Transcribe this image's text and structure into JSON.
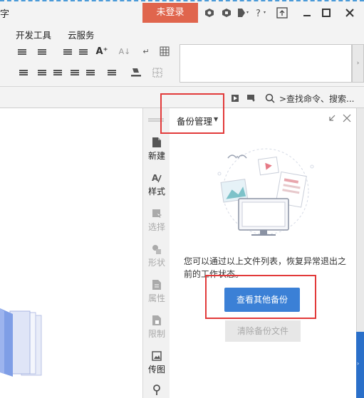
{
  "window": {
    "title_fragment": "字",
    "login_label": "未登录"
  },
  "menu": {
    "items": [
      "开发工具",
      "云服务"
    ]
  },
  "searchbar": {
    "label": ">查找命令、搜索..."
  },
  "toolstrip": {
    "items": [
      {
        "label": "新建",
        "icon": "new-doc-icon",
        "enabled": true
      },
      {
        "label": "样式",
        "icon": "style-icon",
        "enabled": true
      },
      {
        "label": "选择",
        "icon": "select-icon",
        "enabled": false
      },
      {
        "label": "形状",
        "icon": "shape-icon",
        "enabled": false
      },
      {
        "label": "属性",
        "icon": "property-icon",
        "enabled": false
      },
      {
        "label": "限制",
        "icon": "restrict-icon",
        "enabled": false
      },
      {
        "label": "传图",
        "icon": "upload-image-icon",
        "enabled": true
      }
    ]
  },
  "backup_pane": {
    "title": "备份管理",
    "description": "您可以通过以上文件列表，恢复异常退出之前的工作状态。",
    "view_other_label": "查看其他备份",
    "clear_label": "清除备份文件"
  },
  "colors": {
    "login_bg": "#e0654d",
    "primary_button": "#3b80d6",
    "highlight_border": "#e23a3a",
    "scroll_thumb": "#2a6fc9"
  }
}
